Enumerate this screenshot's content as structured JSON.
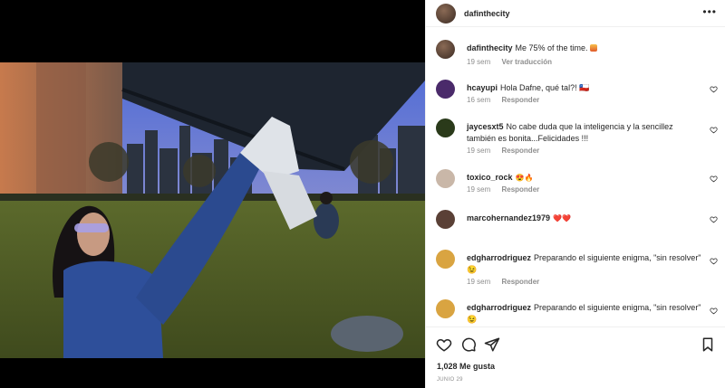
{
  "post": {
    "username": "dafinthecity",
    "more_label": "•••",
    "caption": {
      "username": "dafinthecity",
      "text": "Me 75% of the time.",
      "emoji": "sunset-emoji",
      "time": "19 sem",
      "translate": "Ver traducción"
    },
    "comments": [
      {
        "username": "hcayupi",
        "text": "Hola Dafne, qué tal?! 🇨🇱",
        "time": "16 sem",
        "reply": "Responder",
        "avatar_color": "#4a2a6a"
      },
      {
        "username": "jaycesxt5",
        "text": "No cabe duda que la inteligencia y la sencillez también es bonita...Felicidades !!!",
        "time": "19 sem",
        "reply": "Responder",
        "avatar_color": "#2a3a1a"
      },
      {
        "username": "toxico_rock",
        "text": "😍🔥",
        "time": "19 sem",
        "reply": "Responder",
        "avatar_color": "#c9b7a8"
      },
      {
        "username": "marcohernandez1979",
        "text": "❤️❤️",
        "time": "",
        "reply": "",
        "avatar_color": "#5a4036"
      },
      {
        "username": "edgharrodriguez",
        "text": "Preparando el siguiente enigma, \"sin resolver\" 😉",
        "time": "19 sem",
        "reply": "Responder",
        "avatar_color": "#d9a441"
      },
      {
        "username": "edgharrodriguez",
        "text": "Preparando el siguiente enigma, \"sin resolver\" 😉",
        "time": "",
        "reply": "",
        "avatar_color": "#d9a441"
      }
    ],
    "likes": "1,028 Me gusta",
    "date": "JUNIO 29"
  }
}
